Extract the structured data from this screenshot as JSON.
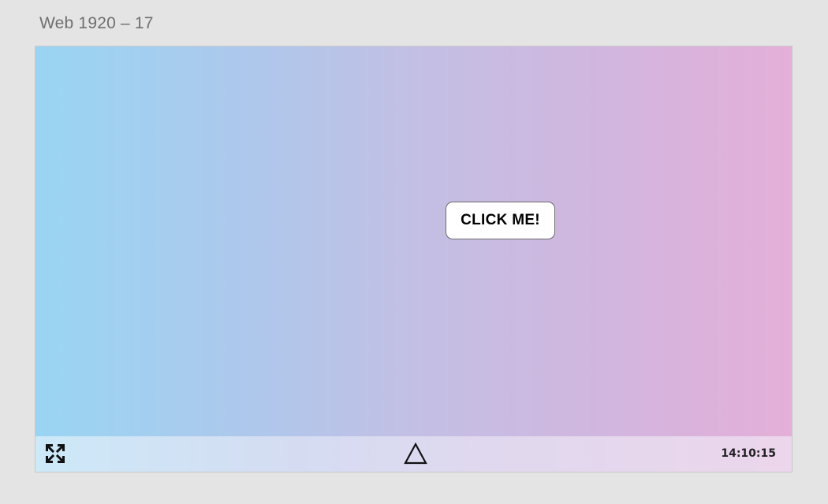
{
  "artboard": {
    "title": "Web 1920 – 17"
  },
  "main": {
    "button_label": "CLICK ME!"
  },
  "bottom_bar": {
    "fullscreen_icon": "fullscreen-expand-icon",
    "center_icon": "triangle-outline-icon",
    "clock": "14:10:15"
  },
  "colors": {
    "gradient_start": "#99d5f3",
    "gradient_end": "#e4afd8",
    "page_background": "#e4e4e4"
  }
}
